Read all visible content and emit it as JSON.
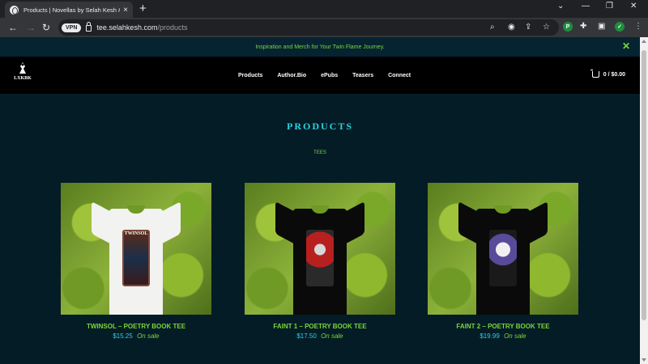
{
  "browser": {
    "tab_title": "Products | Novellas by Selah Kesh #",
    "tab_close": "×",
    "new_tab": "+",
    "url_host": "tee.selahkesh.com",
    "url_path": "/products",
    "vpn_label": "VPN",
    "window_controls": [
      "⌄",
      "—",
      "❐",
      "✕"
    ],
    "extensions": [
      {
        "label": "P",
        "color": "#1e8e3e"
      },
      {
        "label": "✓",
        "color": "#1e8e3e"
      }
    ]
  },
  "announcement": {
    "text": "Inspiration and Merch for Your Twin Flame Journey.",
    "close": "✕"
  },
  "header": {
    "logo_text": "LXKBK",
    "nav": [
      "Products",
      "Author.Bio",
      "ePubs",
      "Teasers",
      "Connect"
    ],
    "cart_label": "0 / $0.00"
  },
  "page": {
    "title": "PRODUCTS",
    "category": "TEES"
  },
  "products": [
    {
      "name": "TWINSOL – POETRY BOOK TEE",
      "price": "$15.25",
      "sale": "On sale",
      "print_title": "TWINSOL",
      "shirt": "white"
    },
    {
      "name": "FAINT 1 – POETRY BOOK TEE",
      "price": "$17.50",
      "sale": "On sale",
      "print_title": "",
      "shirt": "black"
    },
    {
      "name": "FAINT 2 – POETRY BOOK TEE",
      "price": "$19.99",
      "sale": "On sale",
      "print_title": "",
      "shirt": "black"
    }
  ],
  "colors": {
    "page_bg": "#041c26",
    "accent_green": "#7bd63a",
    "accent_cyan": "#2ad3e0"
  }
}
